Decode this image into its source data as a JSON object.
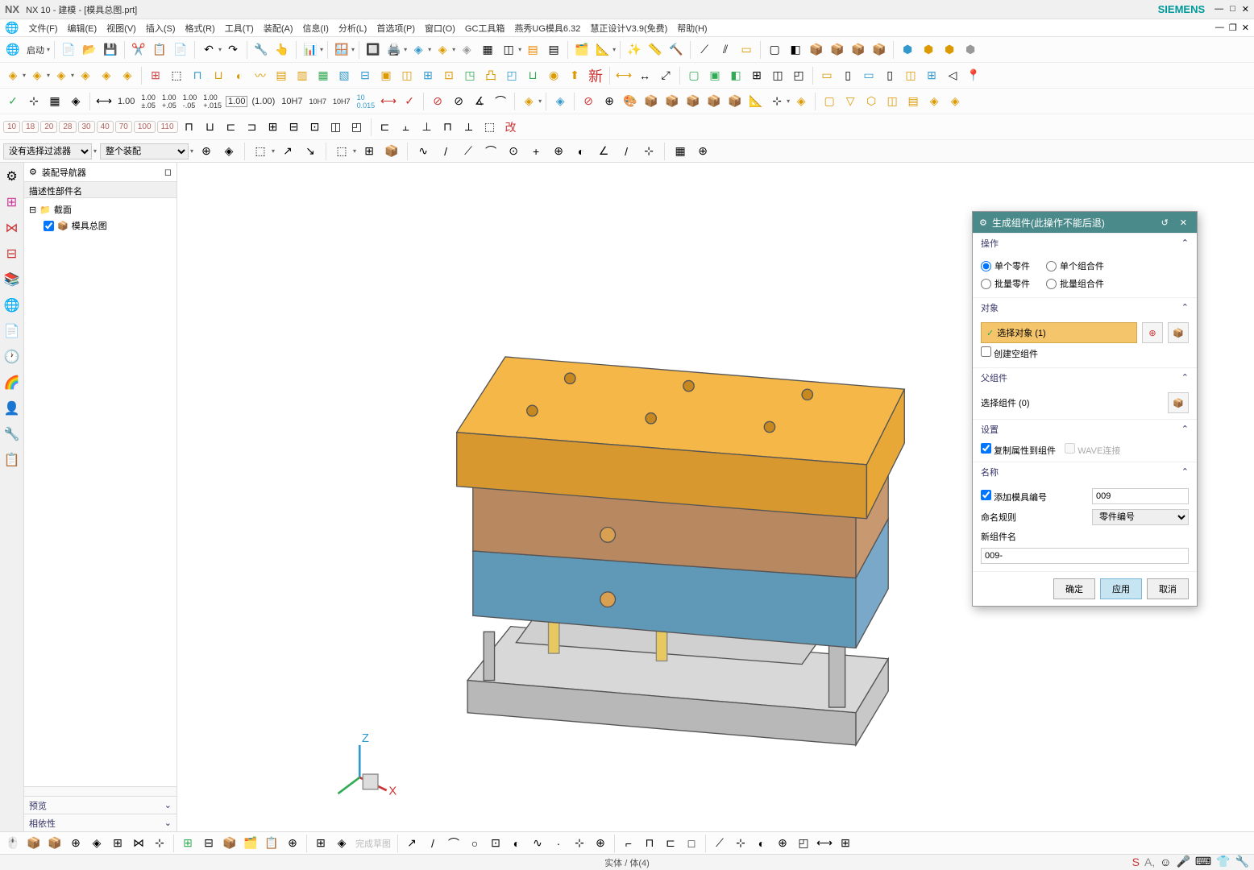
{
  "title": {
    "app": "NX",
    "ver": "NX 10",
    "mode": "- 建模 -",
    "doc": "[模具总图.prt]",
    "brand": "SIEMENS"
  },
  "menu": {
    "items": [
      "文件(F)",
      "编辑(E)",
      "视图(V)",
      "插入(S)",
      "格式(R)",
      "工具(T)",
      "装配(A)",
      "信息(I)",
      "分析(L)",
      "首选项(P)",
      "窗口(O)",
      "GC工具箱",
      "燕秀UG模具6.32",
      "慧正设计V3.9(免费)",
      "帮助(H)"
    ]
  },
  "toolbar": {
    "start": "启动",
    "nums": [
      "10",
      "18",
      "20",
      "28",
      "30",
      "40",
      "70",
      "100",
      "110"
    ],
    "t1": "1.00",
    "t2": "1.00",
    "tH1": "10H7",
    "tH2": "10H7",
    "tH3": "10H7",
    "x": "新"
  },
  "filter": {
    "noFilter": "没有选择过滤器",
    "assembly": "整个装配"
  },
  "nav": {
    "title": "装配导航器",
    "col": "描述性部件名",
    "n1": "截面",
    "n2": "模具总图",
    "preview": "预览",
    "dependency": "相依性"
  },
  "dialog": {
    "title": "生成组件(此操作不能后退)",
    "s1": "操作",
    "r1": "单个零件",
    "r2": "单个组合件",
    "r3": "批量零件",
    "r4": "批量组合件",
    "s2": "对象",
    "sel": "选择对象 (1)",
    "empty": "创建空组件",
    "s3": "父组件",
    "parent": "选择组件 (0)",
    "s4": "设置",
    "copy": "复制属性到组件",
    "wave": "WAVE连接",
    "s5": "名称",
    "addNo": "添加模具编号",
    "addNoVal": "009",
    "rule": "命名规则",
    "ruleVal": "零件编号",
    "newName": "新组件名",
    "newVal": "009-",
    "ok": "确定",
    "apply": "应用",
    "cancel": "取消"
  },
  "status": "实体 / 体(4)"
}
